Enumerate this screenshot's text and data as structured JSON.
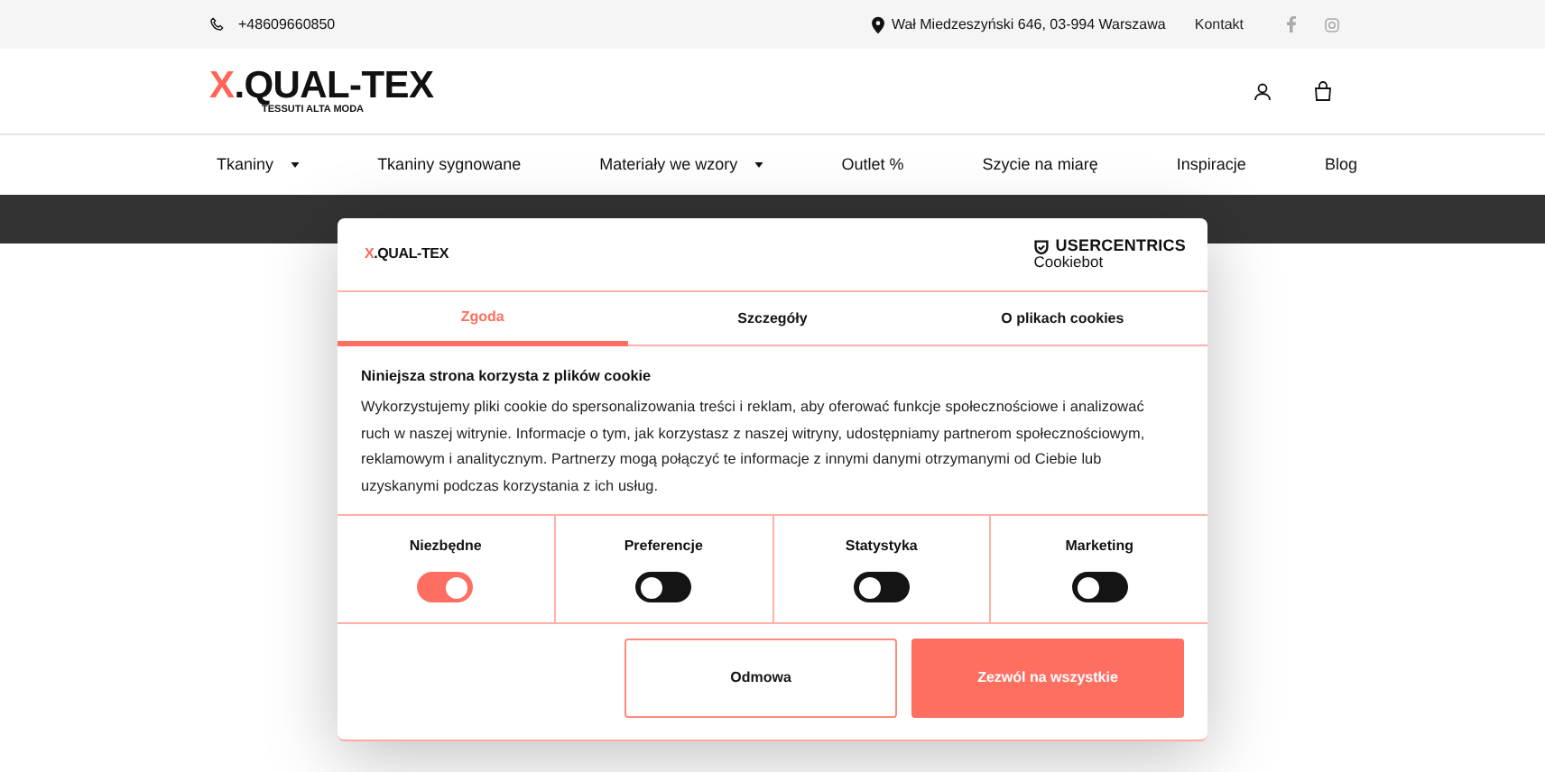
{
  "top_bar": {
    "phone": "+48609660850",
    "address": "Wał Miedzeszyński 646, 03-994 Warszawa",
    "contact_link": "Kontakt"
  },
  "header": {
    "logo_mark": "X",
    "logo_text": ".QUAL-TEX",
    "logo_tagline": "TESSUTI ALTA MODA"
  },
  "nav": [
    {
      "label": "Tkaniny",
      "dropdown": true
    },
    {
      "label": "Tkaniny sygnowane",
      "dropdown": false
    },
    {
      "label": "Materiały we wzory",
      "dropdown": true
    },
    {
      "label": "Outlet %",
      "dropdown": false
    },
    {
      "label": "Szycie na miarę",
      "dropdown": false
    },
    {
      "label": "Inspiracje",
      "dropdown": false
    },
    {
      "label": "Blog",
      "dropdown": false
    }
  ],
  "cookie_dialog": {
    "logo_mark": "X",
    "logo_text": ".QUAL-TEX",
    "provider": "USERCENTRICS",
    "provider_sub": "Cookiebot",
    "tabs": [
      {
        "label": "Zgoda",
        "selected": true
      },
      {
        "label": "Szczegóły",
        "selected": false
      },
      {
        "label": "O plikach cookies",
        "selected": false
      }
    ],
    "title": "Niniejsza strona korzysta z plików cookie",
    "text": "Wykorzystujemy pliki cookie do spersonalizowania treści i reklam, aby oferować funkcje społecznościowe i analizować ruch w naszej witrynie. Informacje o tym, jak korzystasz z naszej witryny, udostępniamy partnerom społecznościowym, reklamowym i analitycznym. Partnerzy mogą połączyć te informacje z innymi danymi otrzymanymi od Ciebie lub uzyskanymi podczas korzystania z ich usług.",
    "categories": [
      {
        "label": "Niezbędne",
        "on": true
      },
      {
        "label": "Preferencje",
        "on": false
      },
      {
        "label": "Statystyka",
        "on": false
      },
      {
        "label": "Marketing",
        "on": false
      }
    ],
    "buttons": [
      {
        "label": "Odmowa",
        "kind": "outline"
      },
      {
        "label": "Zezwól na wszystkie",
        "kind": "filled"
      }
    ]
  }
}
